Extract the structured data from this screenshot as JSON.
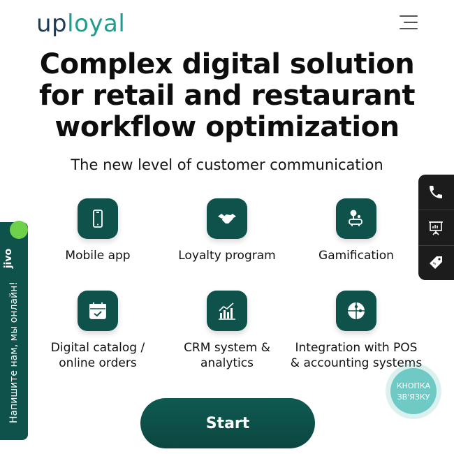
{
  "header": {
    "logo_part1": "up",
    "logo_part2": "loyal",
    "menu_icon": "hamburger-icon"
  },
  "hero": {
    "title_line1": "Complex digital solution",
    "title_line2": "for retail and restaurant",
    "title_line3": "workflow optimization",
    "subtitle": "The new level of customer communication"
  },
  "features": [
    {
      "label_line1": "Mobile app",
      "label_line2": "",
      "icon": "smartphone-icon"
    },
    {
      "label_line1": "Loyalty program",
      "label_line2": "",
      "icon": "handshake-icon"
    },
    {
      "label_line1": "Gamification",
      "label_line2": "",
      "icon": "joystick-icon"
    },
    {
      "label_line1": "Digital catalog /",
      "label_line2": "online orders",
      "icon": "calendar-check-icon"
    },
    {
      "label_line1": "CRM system &",
      "label_line2": "analytics",
      "icon": "bar-chart-icon"
    },
    {
      "label_line1": "Integration with POS",
      "label_line2": "& accounting systems",
      "icon": "puzzle-icon"
    }
  ],
  "cta": {
    "start_label": "Start"
  },
  "side_panel": {
    "items": [
      {
        "icon": "phone-icon"
      },
      {
        "icon": "presentation-icon"
      },
      {
        "icon": "price-tag-icon"
      }
    ]
  },
  "jivo": {
    "brand": "jivo",
    "chat_text": "Напишите нам, мы онлайн!"
  },
  "contact_button": {
    "line1": "КНОПКА",
    "line2": "ЗВ'ЯЗКУ"
  },
  "colors": {
    "brand_dark": "#1f3a56",
    "brand_teal": "#1f9c8d",
    "tile_green": "#0e524b",
    "panel_dark": "#1c1c1c",
    "contact_teal": "#6fc9c4"
  }
}
